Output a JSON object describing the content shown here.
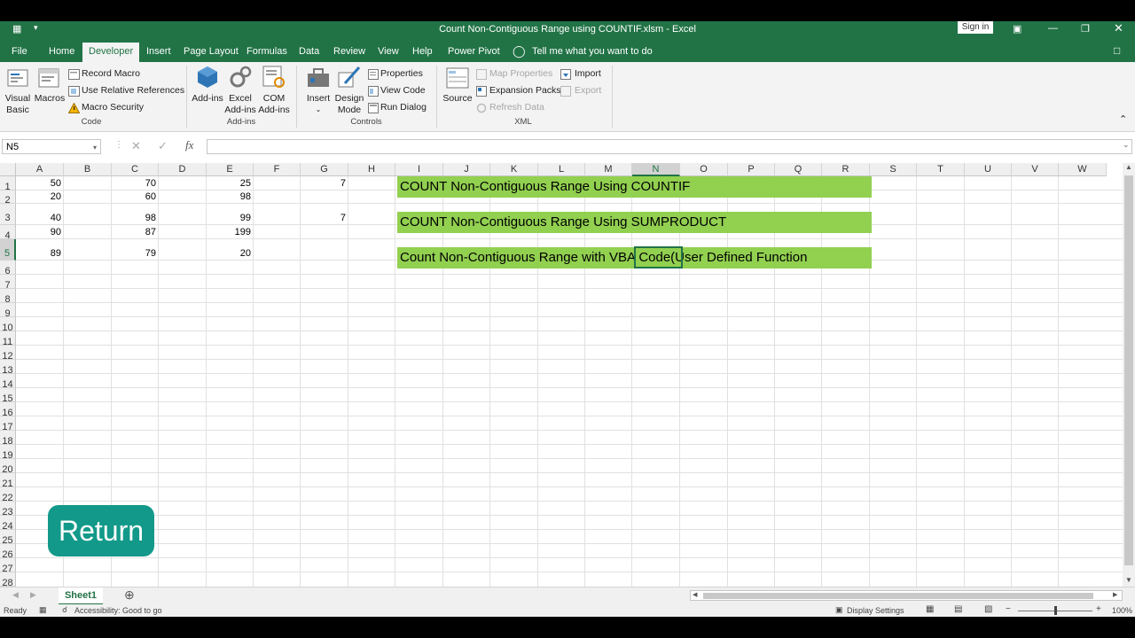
{
  "window": {
    "title": "Count Non-Contiguous Range using COUNTIF.xlsm  -  Excel",
    "sign_in": "Sign in"
  },
  "tabs": [
    "File",
    "Home",
    "Developer",
    "Insert",
    "Page Layout",
    "Formulas",
    "Data",
    "Review",
    "View",
    "Help",
    "Power Pivot"
  ],
  "active_tab": "Developer",
  "tell_me": "Tell me what you want to do",
  "ribbon": {
    "code": {
      "visual_basic": "Visual Basic",
      "macros": "Macros",
      "record_macro": "Record Macro",
      "use_relative": "Use Relative References",
      "macro_security": "Macro Security",
      "group": "Code"
    },
    "addins": {
      "addins": "Add-ins",
      "excel_addins": "Excel Add-ins",
      "com_addins": "COM Add-ins",
      "group": "Add-ins"
    },
    "controls": {
      "insert": "Insert",
      "design_mode": "Design Mode",
      "properties": "Properties",
      "view_code": "View Code",
      "run_dialog": "Run Dialog",
      "group": "Controls"
    },
    "xml": {
      "source": "Source",
      "map_properties": "Map Properties",
      "expansion_packs": "Expansion Packs",
      "refresh_data": "Refresh Data",
      "import": "Import",
      "export": "Export",
      "group": "XML"
    }
  },
  "name_box": "N5",
  "fx": "fx",
  "columns": [
    "A",
    "B",
    "C",
    "D",
    "E",
    "F",
    "G",
    "H",
    "I",
    "J",
    "K",
    "L",
    "M",
    "N",
    "O",
    "P",
    "Q",
    "R",
    "S",
    "T",
    "U",
    "V",
    "W"
  ],
  "rows": [
    "1",
    "2",
    "3",
    "4",
    "5",
    "6",
    "7",
    "8",
    "9",
    "10",
    "11",
    "12",
    "13",
    "14",
    "15",
    "16",
    "17",
    "18",
    "19",
    "20",
    "21",
    "22",
    "23",
    "24",
    "25",
    "26",
    "27",
    "28"
  ],
  "cells": {
    "A1": "50",
    "C1": "70",
    "E1": "25",
    "G1": "7",
    "A2": "20",
    "C2": "60",
    "E2": "98",
    "A3": "40",
    "C3": "98",
    "E3": "99",
    "G3": "7",
    "A4": "90",
    "C4": "87",
    "E4": "199",
    "A5": "89",
    "C5": "79",
    "E5": "20"
  },
  "headings": {
    "row1": "COUNT Non-Contiguous Range Using COUNTIF",
    "row3": "COUNT Non-Contiguous Range Using SUMPRODUCT",
    "row5": "Count Non-Contiguous Range with VBA Code(User Defined Function"
  },
  "return_button": "Return",
  "sheet_tab": "Sheet1",
  "status": {
    "ready": "Ready",
    "accessibility": "Accessibility: Good to go",
    "display_settings": "Display Settings",
    "zoom": "100%"
  },
  "colors": {
    "excel_green": "#217346",
    "heading_fill": "#92d050",
    "return_fill": "#12998a"
  }
}
